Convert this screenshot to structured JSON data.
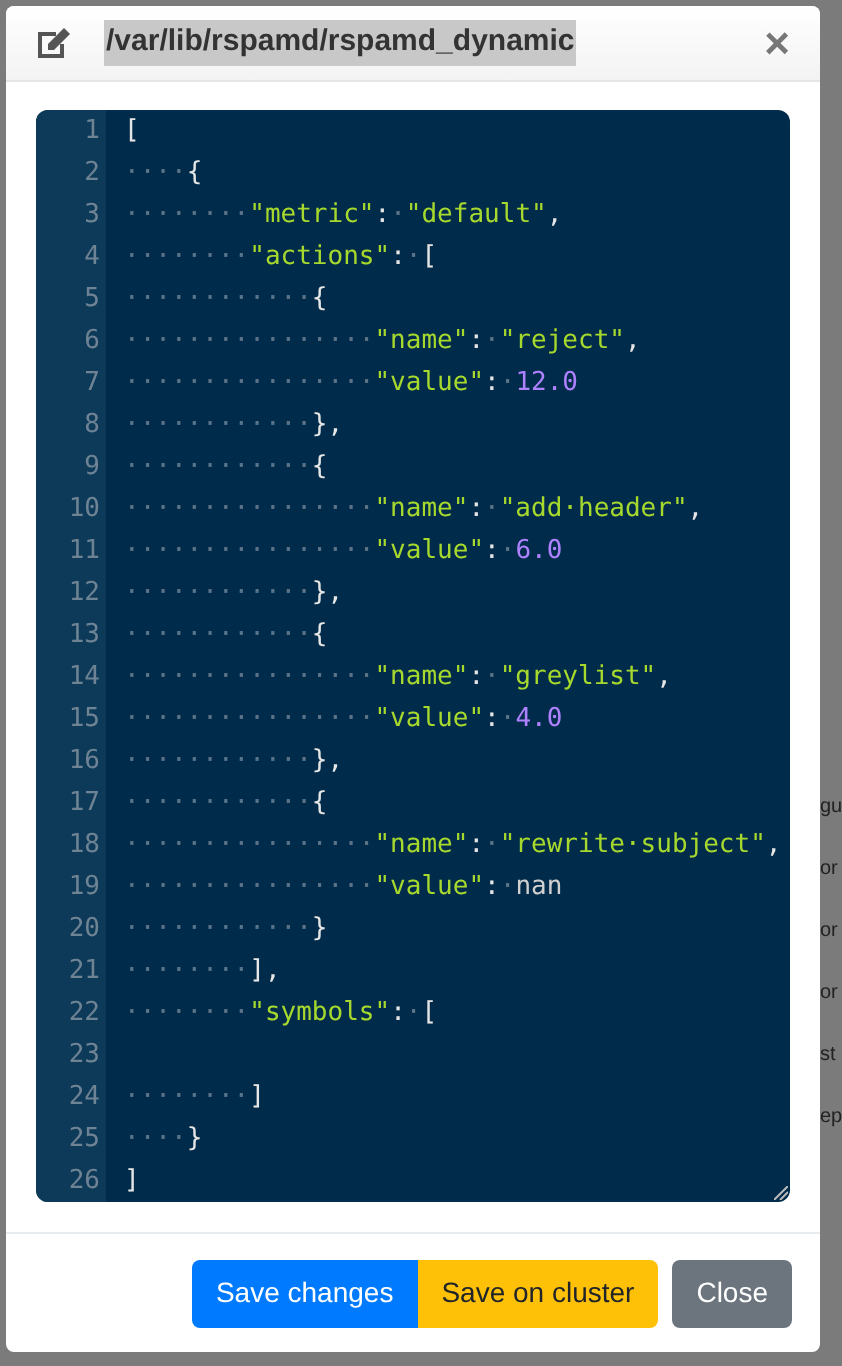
{
  "background_fragments": [
    "gu",
    "or",
    "or",
    "or",
    "st",
    "ep"
  ],
  "modal": {
    "title": "/var/lib/rspamd/rspamd_dynamic",
    "title_selected": true,
    "close": "×",
    "editor": {
      "lines": [
        {
          "number": "1",
          "tokens": [
            {
              "kind": "punct",
              "text": "["
            }
          ]
        },
        {
          "number": "2",
          "tokens": [
            {
              "kind": "ws",
              "text": "····"
            },
            {
              "kind": "punct",
              "text": "{"
            }
          ]
        },
        {
          "number": "3",
          "tokens": [
            {
              "kind": "ws",
              "text": "········"
            },
            {
              "kind": "string",
              "text": "\"metric\""
            },
            {
              "kind": "punct",
              "text": ":"
            },
            {
              "kind": "ws",
              "text": "·"
            },
            {
              "kind": "string",
              "text": "\"default\""
            },
            {
              "kind": "punct",
              "text": ","
            }
          ]
        },
        {
          "number": "4",
          "tokens": [
            {
              "kind": "ws",
              "text": "········"
            },
            {
              "kind": "string",
              "text": "\"actions\""
            },
            {
              "kind": "punct",
              "text": ":"
            },
            {
              "kind": "ws",
              "text": "·"
            },
            {
              "kind": "punct",
              "text": "["
            }
          ]
        },
        {
          "number": "5",
          "tokens": [
            {
              "kind": "ws",
              "text": "············"
            },
            {
              "kind": "punct",
              "text": "{"
            }
          ]
        },
        {
          "number": "6",
          "tokens": [
            {
              "kind": "ws",
              "text": "················"
            },
            {
              "kind": "string",
              "text": "\"name\""
            },
            {
              "kind": "punct",
              "text": ":"
            },
            {
              "kind": "ws",
              "text": "·"
            },
            {
              "kind": "string",
              "text": "\"reject\""
            },
            {
              "kind": "punct",
              "text": ","
            }
          ]
        },
        {
          "number": "7",
          "tokens": [
            {
              "kind": "ws",
              "text": "················"
            },
            {
              "kind": "string",
              "text": "\"value\""
            },
            {
              "kind": "punct",
              "text": ":"
            },
            {
              "kind": "ws",
              "text": "·"
            },
            {
              "kind": "number",
              "text": "12.0"
            }
          ]
        },
        {
          "number": "8",
          "tokens": [
            {
              "kind": "ws",
              "text": "············"
            },
            {
              "kind": "punct",
              "text": "},"
            }
          ]
        },
        {
          "number": "9",
          "tokens": [
            {
              "kind": "ws",
              "text": "············"
            },
            {
              "kind": "punct",
              "text": "{"
            }
          ]
        },
        {
          "number": "10",
          "tokens": [
            {
              "kind": "ws",
              "text": "················"
            },
            {
              "kind": "string",
              "text": "\"name\""
            },
            {
              "kind": "punct",
              "text": ":"
            },
            {
              "kind": "ws",
              "text": "·"
            },
            {
              "kind": "string",
              "text": "\"add·header\""
            },
            {
              "kind": "punct",
              "text": ","
            }
          ]
        },
        {
          "number": "11",
          "tokens": [
            {
              "kind": "ws",
              "text": "················"
            },
            {
              "kind": "string",
              "text": "\"value\""
            },
            {
              "kind": "punct",
              "text": ":"
            },
            {
              "kind": "ws",
              "text": "·"
            },
            {
              "kind": "number",
              "text": "6.0"
            }
          ]
        },
        {
          "number": "12",
          "tokens": [
            {
              "kind": "ws",
              "text": "············"
            },
            {
              "kind": "punct",
              "text": "},"
            }
          ]
        },
        {
          "number": "13",
          "tokens": [
            {
              "kind": "ws",
              "text": "············"
            },
            {
              "kind": "punct",
              "text": "{"
            }
          ]
        },
        {
          "number": "14",
          "tokens": [
            {
              "kind": "ws",
              "text": "················"
            },
            {
              "kind": "string",
              "text": "\"name\""
            },
            {
              "kind": "punct",
              "text": ":"
            },
            {
              "kind": "ws",
              "text": "·"
            },
            {
              "kind": "string",
              "text": "\"greylist\""
            },
            {
              "kind": "punct",
              "text": ","
            }
          ]
        },
        {
          "number": "15",
          "tokens": [
            {
              "kind": "ws",
              "text": "················"
            },
            {
              "kind": "string",
              "text": "\"value\""
            },
            {
              "kind": "punct",
              "text": ":"
            },
            {
              "kind": "ws",
              "text": "·"
            },
            {
              "kind": "number",
              "text": "4.0"
            }
          ]
        },
        {
          "number": "16",
          "tokens": [
            {
              "kind": "ws",
              "text": "············"
            },
            {
              "kind": "punct",
              "text": "},"
            }
          ]
        },
        {
          "number": "17",
          "tokens": [
            {
              "kind": "ws",
              "text": "············"
            },
            {
              "kind": "punct",
              "text": "{"
            }
          ]
        },
        {
          "number": "18",
          "tokens": [
            {
              "kind": "ws",
              "text": "················"
            },
            {
              "kind": "string",
              "text": "\"name\""
            },
            {
              "kind": "punct",
              "text": ":"
            },
            {
              "kind": "ws",
              "text": "·"
            },
            {
              "kind": "string",
              "text": "\"rewrite·subject\""
            },
            {
              "kind": "punct",
              "text": ","
            }
          ]
        },
        {
          "number": "19",
          "tokens": [
            {
              "kind": "ws",
              "text": "················"
            },
            {
              "kind": "string",
              "text": "\"value\""
            },
            {
              "kind": "punct",
              "text": ":"
            },
            {
              "kind": "ws",
              "text": "·"
            },
            {
              "kind": "plain",
              "text": "nan"
            }
          ]
        },
        {
          "number": "20",
          "tokens": [
            {
              "kind": "ws",
              "text": "············"
            },
            {
              "kind": "punct",
              "text": "}"
            }
          ]
        },
        {
          "number": "21",
          "tokens": [
            {
              "kind": "ws",
              "text": "········"
            },
            {
              "kind": "punct",
              "text": "],"
            }
          ]
        },
        {
          "number": "22",
          "tokens": [
            {
              "kind": "ws",
              "text": "········"
            },
            {
              "kind": "string",
              "text": "\"symbols\""
            },
            {
              "kind": "punct",
              "text": ":"
            },
            {
              "kind": "ws",
              "text": "·"
            },
            {
              "kind": "punct",
              "text": "["
            }
          ]
        },
        {
          "number": "23"
        },
        {
          "number": "24",
          "tokens": [
            {
              "kind": "ws",
              "text": "········"
            },
            {
              "kind": "punct",
              "text": "]"
            }
          ]
        },
        {
          "number": "25",
          "tokens": [
            {
              "kind": "ws",
              "text": "····"
            },
            {
              "kind": "punct",
              "text": "}"
            }
          ]
        },
        {
          "number": "26",
          "tokens": [
            {
              "kind": "punct",
              "text": "]"
            }
          ]
        }
      ]
    },
    "buttons": [
      {
        "label": "Save changes",
        "kind": "primary"
      },
      {
        "label": "Save on cluster",
        "kind": "warning"
      },
      {
        "label": "Close",
        "kind": "secondary"
      }
    ]
  }
}
